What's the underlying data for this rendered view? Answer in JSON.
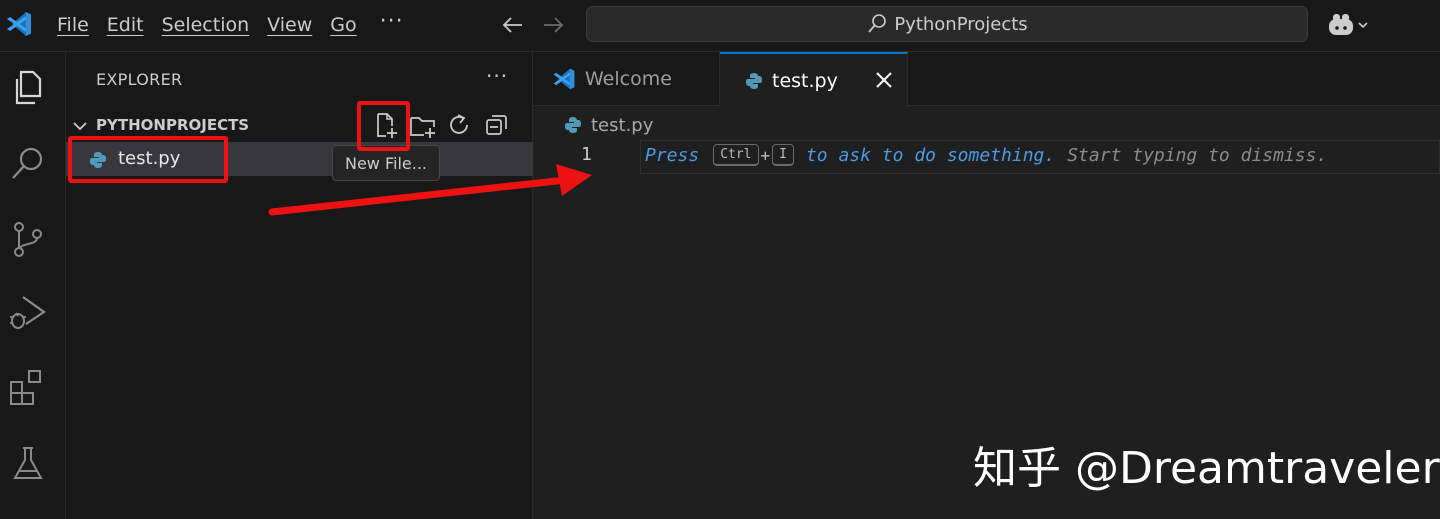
{
  "menu": {
    "items": [
      "File",
      "Edit",
      "Selection",
      "View",
      "Go"
    ],
    "more": "···"
  },
  "command_center": {
    "text": "PythonProjects"
  },
  "sidebar": {
    "title": "EXPLORER",
    "more": "···",
    "folder_name": "PYTHONPROJECTS",
    "files": [
      "test.py"
    ],
    "tooltip": "New File..."
  },
  "editor": {
    "tabs": [
      {
        "label": "Welcome",
        "active": false
      },
      {
        "label": "test.py",
        "active": true
      }
    ],
    "breadcrumb": "test.py",
    "line_number": "1",
    "hint": {
      "press": "Press",
      "key1": "Ctrl",
      "plus": "+",
      "key2": "I",
      "mid": "to ask to do something.",
      "end": "Start typing to dismiss."
    }
  },
  "watermark": "知乎 @Dreamtraveler",
  "colors": {
    "accent": "#0078d4",
    "highlight_red": "#ee1111",
    "hint_blue": "#4a9ae8",
    "python_blue": "#519aba"
  },
  "icons": {
    "activity_bar": [
      "explorer-icon",
      "search-icon",
      "source-control-icon",
      "run-debug-icon",
      "extensions-icon",
      "testing-icon"
    ],
    "folder_actions": [
      "new-file-icon",
      "new-folder-icon",
      "refresh-icon",
      "collapse-all-icon"
    ]
  }
}
